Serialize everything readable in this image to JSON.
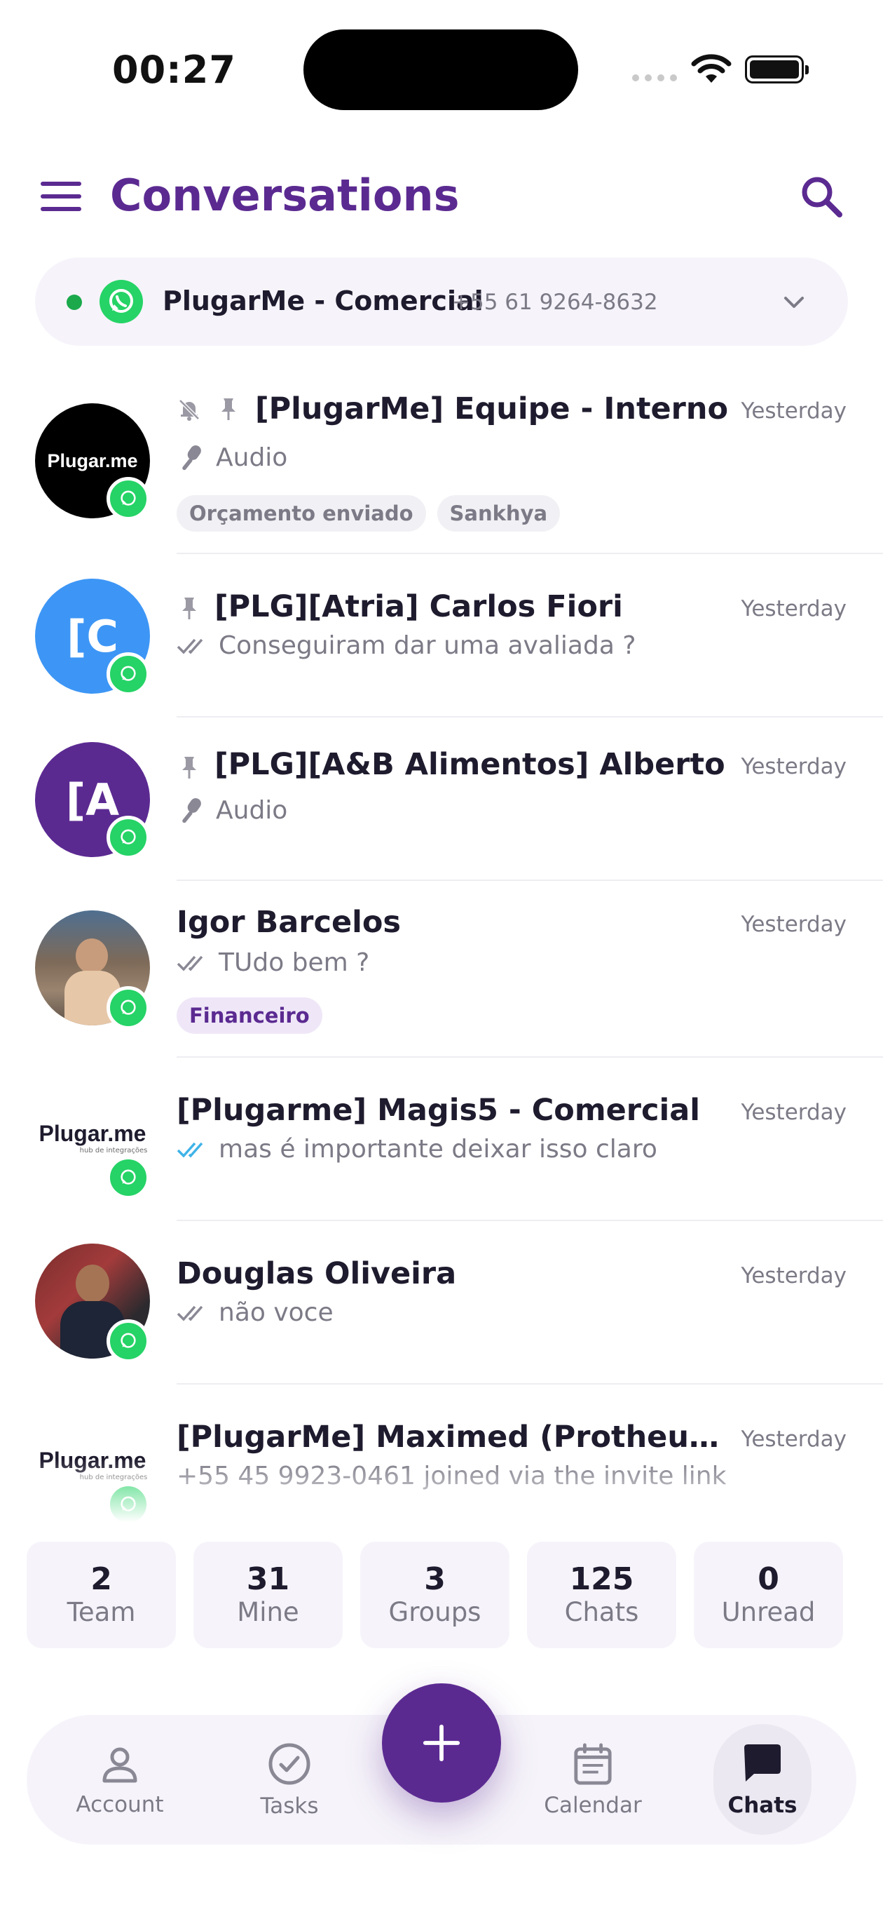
{
  "status": {
    "time": "00:27"
  },
  "header": {
    "title": "Conversations"
  },
  "account": {
    "name": "PlugarMe - Comercial",
    "phone": "+55 61 9264-8632",
    "status_color": "#1ba94c"
  },
  "conversations": [
    {
      "title": "[PlugarMe] Equipe - Interno",
      "time": "Yesterday",
      "preview": "Audio",
      "muted": true,
      "pinned": true,
      "tags": [
        "Orçamento enviado",
        "Sankhya"
      ],
      "avatar_logo": "Plugar.me"
    },
    {
      "title": "[PLG][Atria] Carlos Fiori",
      "time": "Yesterday",
      "preview": "Conseguiram dar uma avaliada ?",
      "pinned": true,
      "avatar_initials": "[C",
      "avatar_color": "#3d96f5"
    },
    {
      "title": "[PLG][A&B Alimentos] Alberto",
      "time": "Yesterday",
      "preview": "Audio",
      "pinned": true,
      "avatar_initials": "[A",
      "avatar_color": "#5b2a91"
    },
    {
      "title": "Igor Barcelos",
      "time": "Yesterday",
      "preview": "TUdo bem ?",
      "tags": [
        "Financeiro"
      ]
    },
    {
      "title": "[Plugarme] Magis5 - Comercial",
      "time": "Yesterday",
      "preview": "mas é importante deixar isso claro",
      "avatar_logo": "Plugar.me",
      "avatar_sub": "hub de integrações"
    },
    {
      "title": "Douglas Oliveira",
      "time": "Yesterday",
      "preview": "não voce"
    },
    {
      "title": "[PlugarMe] Maximed (Protheus x Ma...",
      "time": "Yesterday",
      "preview": "+55 45 9923-0461 joined via the invite link",
      "avatar_logo": "Plugar.me",
      "avatar_sub": "hub de integrações"
    }
  ],
  "filters": [
    {
      "count": "2",
      "label": "Team"
    },
    {
      "count": "31",
      "label": "Mine"
    },
    {
      "count": "3",
      "label": "Groups"
    },
    {
      "count": "125",
      "label": "Chats"
    },
    {
      "count": "0",
      "label": "Unread"
    }
  ],
  "nav": {
    "account": "Account",
    "tasks": "Tasks",
    "calendar": "Calendar",
    "chats": "Chats"
  },
  "colors": {
    "brand": "#5b2a91",
    "whatsapp": "#25d366",
    "read_tick": "#3fb3e8"
  }
}
